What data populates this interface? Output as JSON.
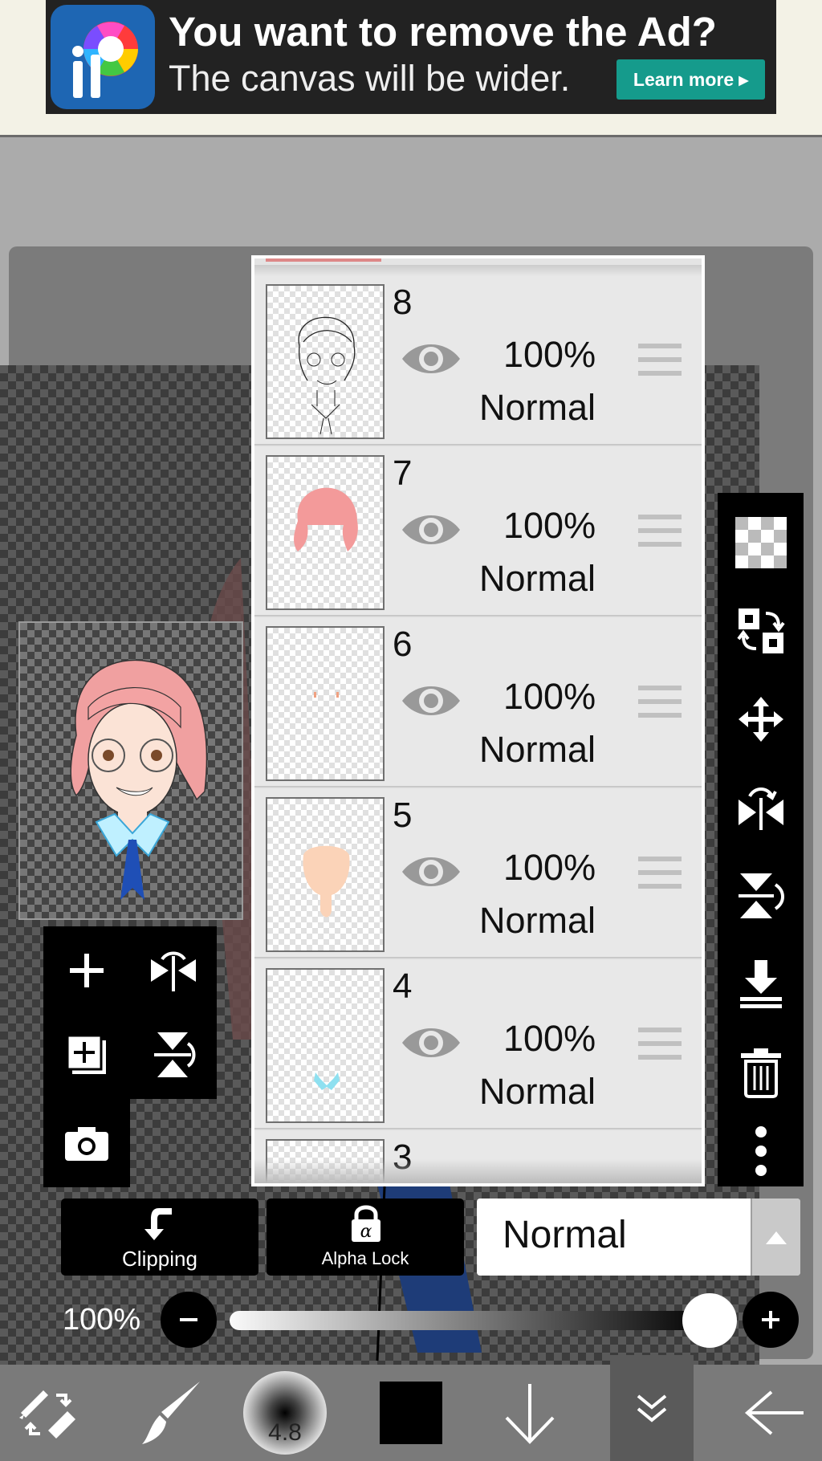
{
  "ad": {
    "title": "You want to remove the Ad?",
    "subtitle": "The canvas will be wider.",
    "cta": "Learn more ▸",
    "logo_text": "iP"
  },
  "layers": [
    {
      "number": "8",
      "opacity": "100%",
      "blend": "Normal"
    },
    {
      "number": "7",
      "opacity": "100%",
      "blend": "Normal"
    },
    {
      "number": "6",
      "opacity": "100%",
      "blend": "Normal"
    },
    {
      "number": "5",
      "opacity": "100%",
      "blend": "Normal"
    },
    {
      "number": "4",
      "opacity": "100%",
      "blend": "Normal"
    },
    {
      "number": "3"
    }
  ],
  "controls": {
    "clipping_label": "Clipping",
    "alpha_lock_label": "Alpha Lock",
    "blend_mode": "Normal",
    "opacity_label": "100%",
    "opacity_value": 1.0
  },
  "bottom_toolbar": {
    "brush_size": "4.8",
    "color": "#000000"
  }
}
